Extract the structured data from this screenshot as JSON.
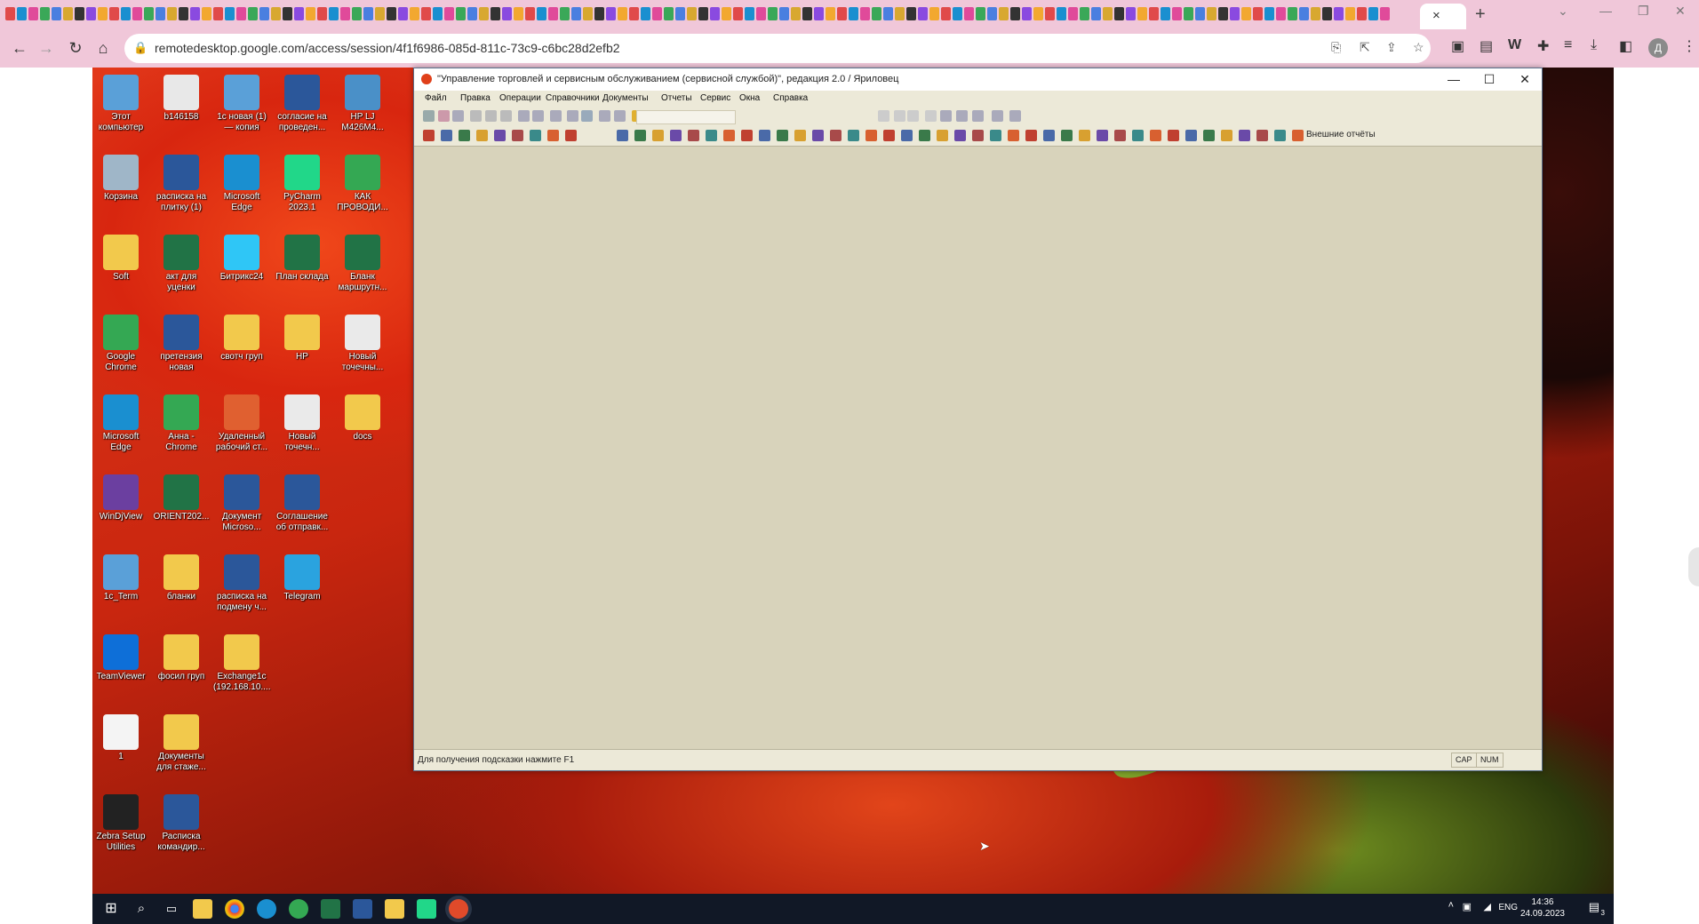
{
  "browser": {
    "url": "remotedesktop.google.com/access/session/4f1f6986-085d-811c-73c9-c6bc28d2efb2",
    "tab_close": "×",
    "new_tab": "+",
    "profile_letter": "Д",
    "colors": {
      "chrome_bg": "#f0c7d9"
    }
  },
  "remote_window": {
    "title": "\"Управление торговлей и сервисным обслуживанием (сервисной службой)\", редакция 2.0 / Яриловец",
    "menu": [
      "Файл",
      "Правка",
      "Операции",
      "Справочники",
      "Документы",
      "Отчеты",
      "Сервис",
      "Окна",
      "Справка"
    ],
    "external_reports": "Внешние отчёты",
    "status_hint": "Для получения подсказки нажмите F1",
    "indicators": [
      "CAP",
      "NUM"
    ]
  },
  "desktop_icons": [
    {
      "label": "Этот компьютер",
      "icon": "computer-icon",
      "color": "#5aa0d8"
    },
    {
      "label": "Корзина",
      "icon": "recycle-bin-icon",
      "color": "#9fb6c8"
    },
    {
      "label": "Soft",
      "icon": "folder-icon",
      "color": "#f2c94c"
    },
    {
      "label": "Google Chrome",
      "icon": "chrome-icon",
      "color": "#34a853"
    },
    {
      "label": "Microsoft Edge",
      "icon": "edge-icon",
      "color": "#1a8fd0"
    },
    {
      "label": "WinDjView",
      "icon": "windjview-icon",
      "color": "#6b3fa0"
    },
    {
      "label": "1c_Term",
      "icon": "remote-computer-icon",
      "color": "#5aa0d8"
    },
    {
      "label": "TeamViewer",
      "icon": "teamviewer-icon",
      "color": "#0e6fd8"
    },
    {
      "label": "1",
      "icon": "text-file-icon",
      "color": "#f4f4f4"
    },
    {
      "label": "Zebra Setup Utilities",
      "icon": "zebra-icon",
      "color": "#222222"
    },
    {
      "label": "b146158",
      "icon": "document-icon",
      "color": "#e8e8e8"
    },
    {
      "label": "расписка на плитку (1)",
      "icon": "word-icon",
      "color": "#2b579a"
    },
    {
      "label": "акт для уценки",
      "icon": "excel-icon",
      "color": "#217346"
    },
    {
      "label": "претензия новая",
      "icon": "word-icon",
      "color": "#2b579a"
    },
    {
      "label": "Анна - Chrome",
      "icon": "chrome-icon",
      "color": "#34a853"
    },
    {
      "label": "ORIENT202...",
      "icon": "excel-icon",
      "color": "#217346"
    },
    {
      "label": "бланки",
      "icon": "folder-icon",
      "color": "#f2c94c"
    },
    {
      "label": "фосил груп",
      "icon": "folder-icon",
      "color": "#f2c94c"
    },
    {
      "label": "Документы для стаже...",
      "icon": "folder-icon",
      "color": "#f2c94c"
    },
    {
      "label": "Расписка командир...",
      "icon": "word-icon",
      "color": "#2b579a"
    },
    {
      "label": "1с новая (1) — копия",
      "icon": "remote-computer-icon",
      "color": "#5aa0d8"
    },
    {
      "label": "Microsoft Edge",
      "icon": "edge-icon",
      "color": "#1a8fd0"
    },
    {
      "label": "Битрикс24",
      "icon": "bitrix-icon",
      "color": "#2fc6f6"
    },
    {
      "label": "свотч груп",
      "icon": "folder-icon",
      "color": "#f2c94c"
    },
    {
      "label": "Удаленный рабочий ст...",
      "icon": "remote-desktop-icon",
      "color": "#e06030"
    },
    {
      "label": "Документ Microso...",
      "icon": "word-icon",
      "color": "#2b579a"
    },
    {
      "label": "расписка на подмену ч...",
      "icon": "word-icon",
      "color": "#2b579a"
    },
    {
      "label": "Exchange1c (192.168.10....",
      "icon": "exchange-icon",
      "color": "#f2c94c"
    },
    {
      "label": "согласие на проведен...",
      "icon": "word-icon",
      "color": "#2b579a"
    },
    {
      "label": "PyCharm 2023.1",
      "icon": "pycharm-icon",
      "color": "#21d789"
    },
    {
      "label": "План склада",
      "icon": "excel-icon",
      "color": "#217346"
    },
    {
      "label": "HP",
      "icon": "folder-icon",
      "color": "#f2c94c"
    },
    {
      "label": "Новый точечн...",
      "icon": "image-icon",
      "color": "#eaeaea"
    },
    {
      "label": "Соглашение об отправк...",
      "icon": "word-icon",
      "color": "#2b579a"
    },
    {
      "label": "Telegram",
      "icon": "telegram-icon",
      "color": "#2aa3df"
    },
    {
      "label": "HP LJ M426M4...",
      "icon": "printer-icon",
      "color": "#4a90c8"
    },
    {
      "label": "КАК ПРОВОДИ...",
      "icon": "chrome-icon",
      "color": "#34a853"
    },
    {
      "label": "Бланк маршрутн...",
      "icon": "excel-icon",
      "color": "#217346"
    },
    {
      "label": "Новый точечны...",
      "icon": "image-icon",
      "color": "#eaeaea"
    },
    {
      "label": "docs",
      "icon": "folder-icon",
      "color": "#f2c94c"
    }
  ],
  "taskbar": {
    "tray_lang": "ENG",
    "time": "14:36",
    "date": "24.09.2023",
    "notifications": "3"
  }
}
